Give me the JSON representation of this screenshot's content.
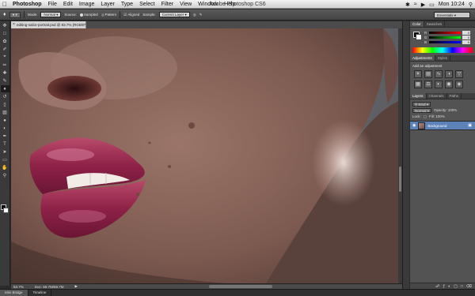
{
  "menubar": {
    "apple": "",
    "items": [
      "Photoshop",
      "File",
      "Edit",
      "Image",
      "Layer",
      "Type",
      "Select",
      "Filter",
      "View",
      "Window",
      "Help"
    ],
    "window_title": "Adobe Photoshop CS6",
    "clock": "Mon 10:24",
    "icons": [
      "bluetooth-icon",
      "wifi-icon",
      "volume-icon",
      "battery-icon",
      "spotlight-icon",
      "user-icon"
    ]
  },
  "options": {
    "mode_label": "Mode:",
    "mode_value": "Normal",
    "source_label": "Source:",
    "sampled_label": "Sampled",
    "pattern_label": "Pattern",
    "aligned_label": "Aligned",
    "sample_label": "Sample:",
    "sample_value": "Current Layer",
    "workspace": "Essentials"
  },
  "document": {
    "tab_title": "editing-sailor-portrait.psd @ 83.7% (RGB/8*)",
    "zoom": "83.7%",
    "doc_size": "Doc: 69.7M/69.7M"
  },
  "bottom_tabs": [
    "Mini Bridge",
    "Timeline"
  ],
  "panels": {
    "color_tabs": [
      "Color",
      "Swatches"
    ],
    "rgb_labels": [
      "R",
      "G",
      "B"
    ],
    "rgb_values": [
      "0",
      "0",
      "0"
    ],
    "adjust_tabs": [
      "Adjustments",
      "Styles"
    ],
    "adjust_title": "Add an adjustment",
    "layers_tabs": [
      "Layers",
      "Channels",
      "Paths"
    ],
    "kind_label": "Kind",
    "blend_mode": "Normal",
    "opacity_label": "Opacity: 100%",
    "lock_label": "Lock:",
    "fill_label": "Fill: 100%",
    "layer_name": "Background"
  },
  "colors": {
    "app_bg": "#535353",
    "layer_selected": "#5c82b8",
    "lip": "#9b2a52"
  }
}
